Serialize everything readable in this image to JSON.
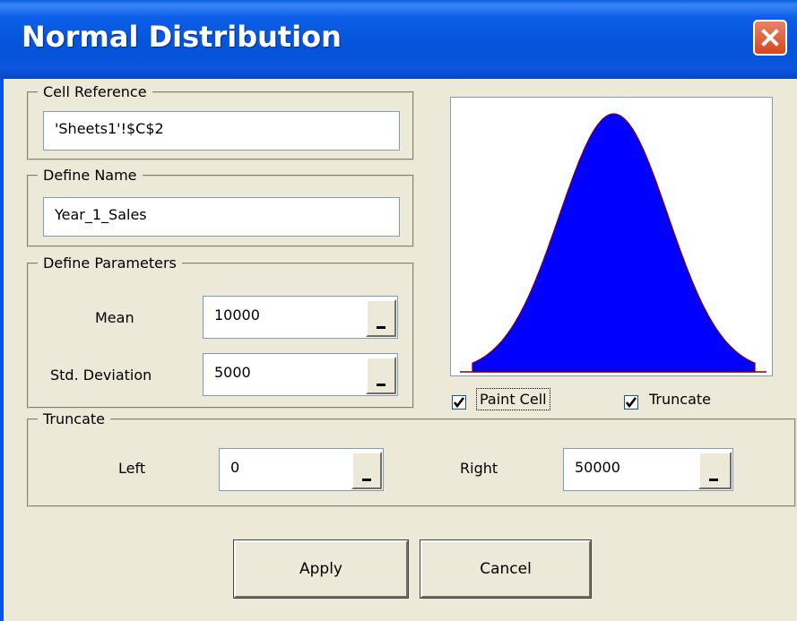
{
  "window": {
    "title": "Normal Distribution"
  },
  "cell_reference": {
    "label": "Cell Reference",
    "value": "'Sheets1'!$C$2"
  },
  "define_name": {
    "label": "Define Name",
    "value": "Year_1_Sales"
  },
  "parameters": {
    "label": "Define Parameters",
    "mean_label": "Mean",
    "mean_value": "10000",
    "std_label": "Std. Deviation",
    "std_value": "5000"
  },
  "options": {
    "paint_cell_label": "Paint Cell",
    "paint_cell_checked": true,
    "truncate_label": "Truncate",
    "truncate_checked": true
  },
  "truncate": {
    "label": "Truncate",
    "left_label": "Left",
    "left_value": "0",
    "right_label": "Right",
    "right_value": "50000"
  },
  "buttons": {
    "apply": "Apply",
    "cancel": "Cancel"
  },
  "preview": {
    "fill_color": "#0000ff",
    "outline_color": "#800000",
    "mean": 10000,
    "std": 5000,
    "lower": 0,
    "upper": 50000
  }
}
